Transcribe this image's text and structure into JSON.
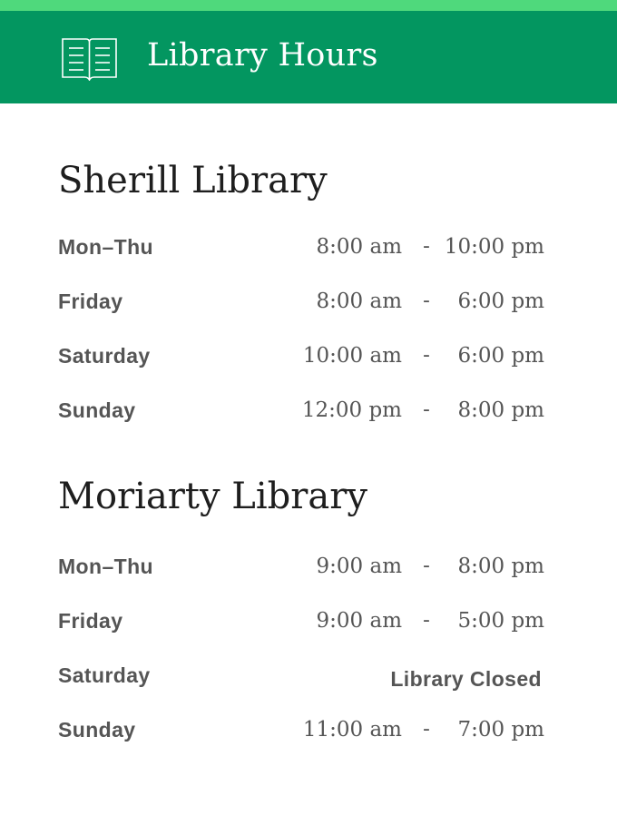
{
  "header": {
    "title": "Library Hours",
    "icon": "open-book-icon",
    "bar_color": "#039660",
    "stripe_color": "#4fd97c"
  },
  "libraries": [
    {
      "name": "Sherill Library",
      "hours": [
        {
          "day": "Mon–Thu",
          "open": "8:00 am",
          "separator": "-",
          "close": "10:00 pm"
        },
        {
          "day": "Friday",
          "open": "8:00 am",
          "separator": "-",
          "close": "6:00 pm"
        },
        {
          "day": "Saturday",
          "open": "10:00 am",
          "separator": "-",
          "close": "6:00 pm"
        },
        {
          "day": "Sunday",
          "open": "12:00 pm",
          "separator": "-",
          "close": "8:00 pm"
        }
      ]
    },
    {
      "name": "Moriarty Library",
      "hours": [
        {
          "day": "Mon–Thu",
          "open": "9:00 am",
          "separator": "-",
          "close": "8:00 pm"
        },
        {
          "day": "Friday",
          "open": "9:00 am",
          "separator": "-",
          "close": "5:00 pm"
        },
        {
          "day": "Saturday",
          "note": "Library Closed"
        },
        {
          "day": "Sunday",
          "open": "11:00 am",
          "separator": "-",
          "close": "7:00 pm"
        }
      ]
    }
  ]
}
